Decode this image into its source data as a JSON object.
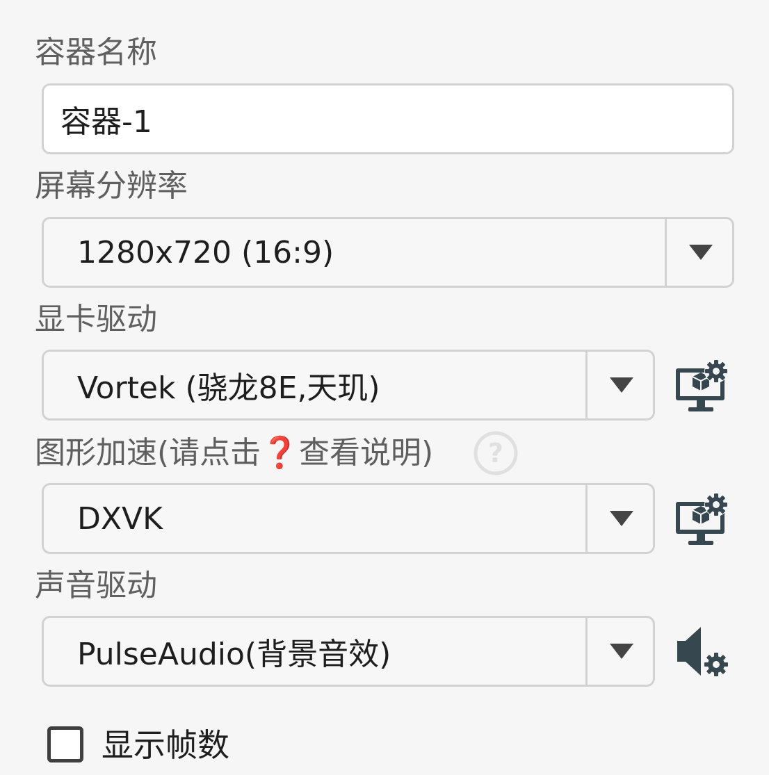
{
  "container_name": {
    "label": "容器名称",
    "value": "容器-1"
  },
  "resolution": {
    "label": "屏幕分辨率",
    "value": "1280x720 (16:9)"
  },
  "graphics_driver": {
    "label": "显卡驱动",
    "value": "Vortek (骁龙8E,天玑)",
    "settings_icon": "monitor-gear-icon"
  },
  "dx_wrapper": {
    "label": "图形加速(请点击❓查看说明)",
    "help_icon": "question-circle-icon",
    "value": "DXVK",
    "settings_icon": "monitor-gear-icon"
  },
  "audio_driver": {
    "label": "声音驱动",
    "value": "PulseAudio(背景音效)",
    "settings_icon": "speaker-gear-icon"
  },
  "show_fps": {
    "label": "显示帧数",
    "checked": false
  },
  "colors": {
    "icon": "#37474f",
    "label_text": "#5f5f5f",
    "border": "#d2d2d2"
  }
}
